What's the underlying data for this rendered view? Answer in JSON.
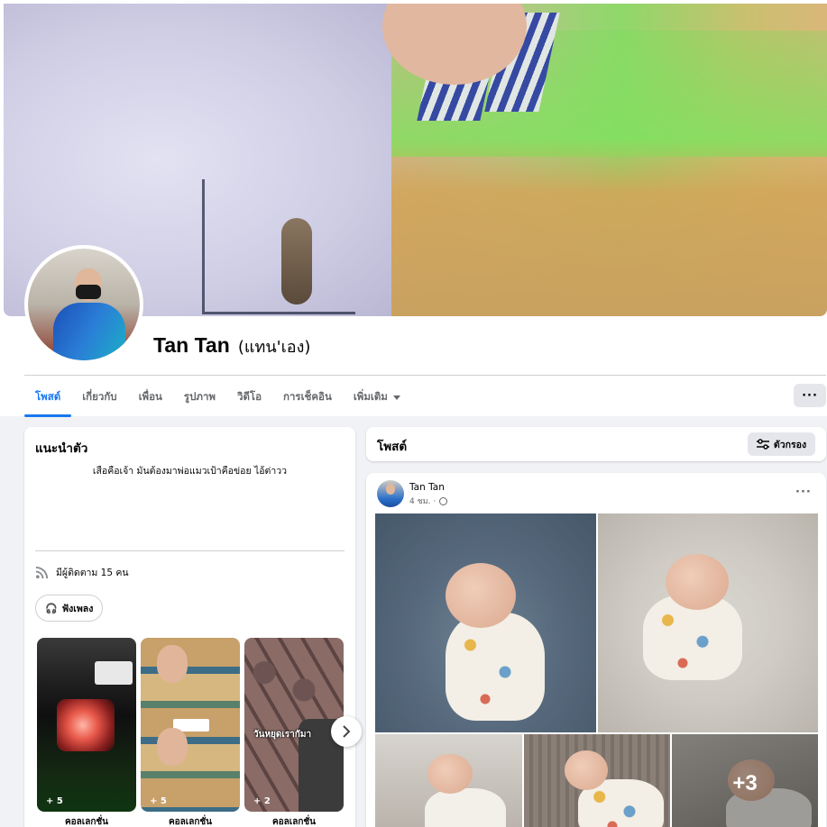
{
  "profile": {
    "name": "Tan Tan",
    "alt_name": "(แทน'เอง)"
  },
  "tabs": [
    {
      "label": "โพสต์",
      "active": true
    },
    {
      "label": "เกี่ยวกับ",
      "active": false
    },
    {
      "label": "เพื่อน",
      "active": false
    },
    {
      "label": "รูปภาพ",
      "active": false
    },
    {
      "label": "วิดีโอ",
      "active": false
    },
    {
      "label": "การเช็คอิน",
      "active": false
    },
    {
      "label": "เพิ่มเติม",
      "active": false
    }
  ],
  "more_menu": "···",
  "intro": {
    "title": "แนะนำตัว",
    "bio": "เสือคือเจ้า มันต้องมาพ่อแมวเป้าคือข่อย ไอ้ต่าวว",
    "followers": "มีผู้ติดตาม 15 คน",
    "music_button": "ฟังเพลง"
  },
  "stories": [
    {
      "count": "+ 5",
      "label": "คอลเลกชั่น"
    },
    {
      "count": "+ 5",
      "label": "คอลเลกชั่น"
    },
    {
      "count": "+ 2",
      "label": "คอลเลกชั่น",
      "caption": "วันหยุดเรากัมา"
    }
  ],
  "posts_header": {
    "title": "โพสต์",
    "filter_label": "ตัวกรอง"
  },
  "post": {
    "author": "Tan Tan",
    "time": "4 ชม. ·",
    "more": "···",
    "more_photos": "+3"
  },
  "colors": {
    "accent": "#1877f2",
    "background": "#f0f2f5",
    "secondary_text": "#65676b"
  }
}
